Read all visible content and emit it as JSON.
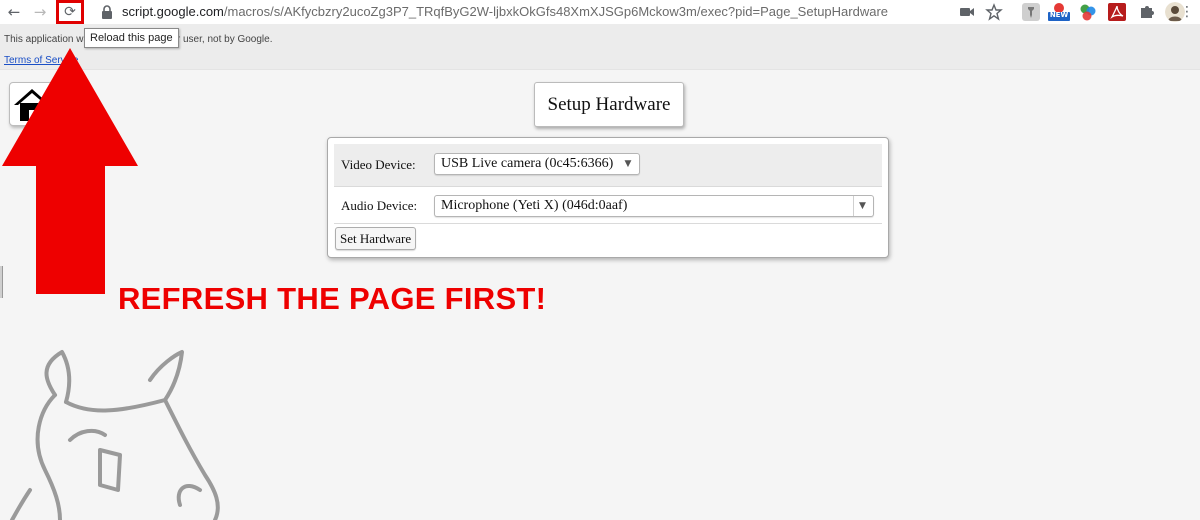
{
  "browser": {
    "nav": {
      "back_glyph": "←",
      "forward_glyph": "→",
      "reload_glyph": "⟳"
    },
    "url_host": "script.google.com",
    "url_path": "/macros/s/AKfycbzry2ucoZg3P7_TRqfByG2W-ljbxkOkGfs48XmXJSGp6Mckow3m/exec?pid=Page_SetupHardware",
    "reload_tooltip": "Reload this page",
    "extensions": [
      {
        "name": "camera-icon"
      },
      {
        "name": "star-icon"
      },
      {
        "name": "pin-extension-icon"
      },
      {
        "name": "new-badge-extension-icon"
      },
      {
        "name": "circles-extension-icon"
      },
      {
        "name": "pdf-extension-icon"
      },
      {
        "name": "puzzle-extensions-icon"
      },
      {
        "name": "profile-avatar"
      }
    ],
    "new_badge": "NEW"
  },
  "banner": {
    "notice": "This application was created by another user, not by Google.",
    "terms_link": "Terms of Service"
  },
  "page": {
    "title": "Setup Hardware",
    "video_label": "Video Device:",
    "video_value": "USB Live camera (0c45:6366)",
    "audio_label": "Audio Device:",
    "audio_value": "Microphone (Yeti X) (046d:0aaf)",
    "set_button": "Set Hardware"
  },
  "annotation": {
    "callout": "REFRESH THE PAGE FIRST!",
    "color": "#ee0000"
  }
}
